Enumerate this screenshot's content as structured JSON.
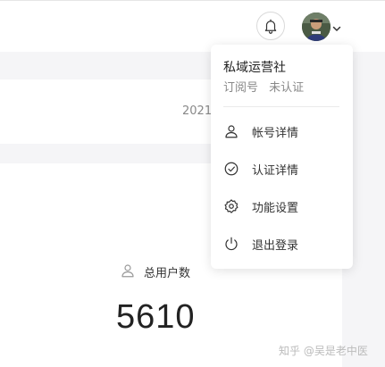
{
  "header": {
    "notification_icon": "bell-icon",
    "avatar": "user-avatar",
    "dropdown_icon": "chevron-down-icon"
  },
  "overview": {
    "date": "2021"
  },
  "stats": {
    "total_users_label": "总用户数",
    "total_users_icon": "user-icon",
    "total_users_value": "5610"
  },
  "account_menu": {
    "account_name": "私域运营社",
    "account_type": "订阅号",
    "verification_status": "未认证",
    "items": [
      {
        "label": "帐号详情",
        "icon": "user-icon"
      },
      {
        "label": "认证详情",
        "icon": "check-circle-icon"
      },
      {
        "label": "功能设置",
        "icon": "gear-icon"
      },
      {
        "label": "退出登录",
        "icon": "power-icon"
      }
    ]
  },
  "watermark": "知乎 @吴是老中医",
  "colors": {
    "page_background": "#f5f5f7",
    "card_background": "#ffffff",
    "text_primary": "#222222",
    "text_secondary": "#888888"
  }
}
